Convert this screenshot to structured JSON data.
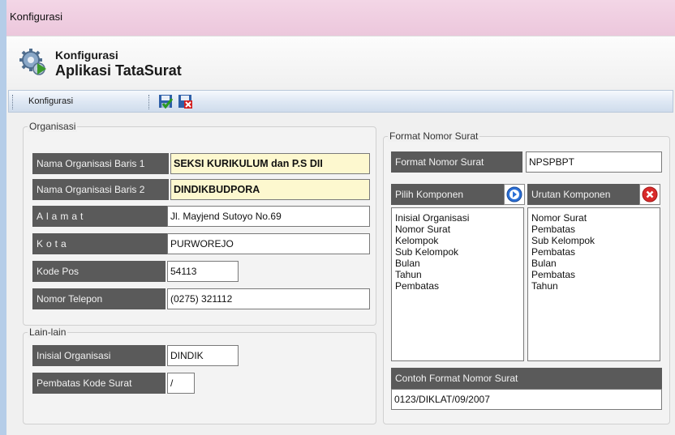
{
  "window": {
    "title": "Konfigurasi"
  },
  "header": {
    "line1": "Konfigurasi",
    "line2": "Aplikasi TataSurat"
  },
  "toolbar": {
    "label": "Konfigurasi"
  },
  "organisasi": {
    "legend": "Organisasi",
    "baris1": {
      "label": "Nama Organisasi Baris 1",
      "value": "SEKSI KURIKULUM dan P.S DII"
    },
    "baris2": {
      "label": "Nama Organisasi Baris 2",
      "value": "DINDIKBUDPORA"
    },
    "alamat": {
      "label": "Alamat",
      "value": "Jl. Mayjend Sutoyo No.69"
    },
    "kota": {
      "label": "Kota",
      "value": "PURWOREJO"
    },
    "kode_pos": {
      "label": "Kode Pos",
      "value": "54113"
    },
    "telepon": {
      "label": "Nomor Telepon",
      "value": "(0275) 321112"
    }
  },
  "lain": {
    "legend": "Lain-lain",
    "inisial": {
      "label": "Inisial Organisasi",
      "value": "DINDIK"
    },
    "pembatas": {
      "label": "Pembatas Kode Surat",
      "value": "/"
    }
  },
  "format": {
    "legend": "Format Nomor Surat",
    "format_label": "Format Nomor Surat",
    "format_value": "NPSPBPT",
    "pilih_label": "Pilih Komponen",
    "urutan_label": "Urutan Komponen",
    "pilih_items": [
      "Inisial Organisasi",
      "Nomor Surat",
      "Kelompok",
      "Sub Kelompok",
      "Bulan",
      "Tahun",
      "Pembatas"
    ],
    "urutan_items": [
      "Nomor Surat",
      "Pembatas",
      "Sub Kelompok",
      "Pembatas",
      "Bulan",
      "Pembatas",
      "Tahun"
    ],
    "contoh_label": "Contoh Format Nomor Surat",
    "contoh_value": "0123/DIKLAT/09/2007"
  }
}
